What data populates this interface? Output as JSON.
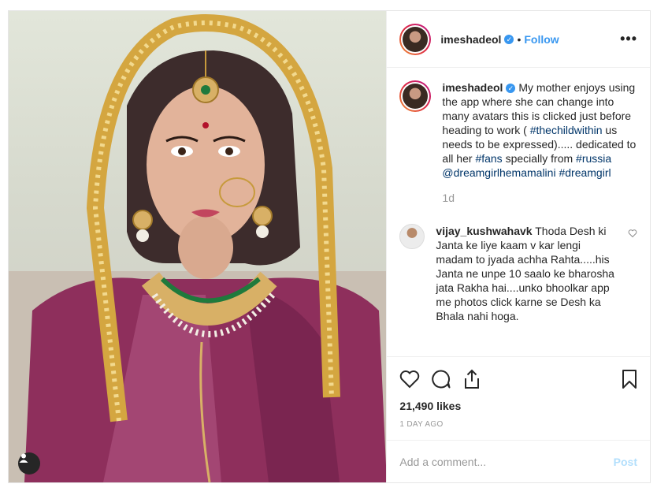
{
  "header": {
    "username": "imeshadeol",
    "verified_icon": "verified-badge-icon",
    "separator": "•",
    "follow_label": "Follow",
    "more_label": "•••"
  },
  "caption": {
    "username": "imeshadeol",
    "text_1": " My mother enjoys using the app where she can change into many avatars this is clicked just before heading to work ( ",
    "tag_1": "#thechildwithin",
    "text_2": " us needs to be expressed)..... dedicated to all her ",
    "tag_2": "#fans",
    "text_3": " specially from ",
    "tag_3": "#russia",
    "text_4": " ",
    "tag_4": "@dreamgirlhemamalini",
    "text_5": " ",
    "tag_5": "#dreamgirl",
    "time": "1d"
  },
  "comment": {
    "username": "vijay_kushwahavk",
    "text": " Thoda Desh ki Janta ke liye kaam v kar lengi madam to jyada achha Rahta.....his Janta ne unpe 10 saalo ke bharosha jata Rakha hai....unko bhoolkar app me photos click karne se Desh ka Bhala nahi hoga."
  },
  "stats": {
    "likes": "21,490 likes",
    "time_ago": "1 DAY AGO"
  },
  "add_comment": {
    "placeholder": "Add a comment...",
    "post_label": "Post"
  },
  "colors": {
    "accent": "#3897f0",
    "post_disabled": "#b2dffc",
    "hashtag": "#003569"
  }
}
